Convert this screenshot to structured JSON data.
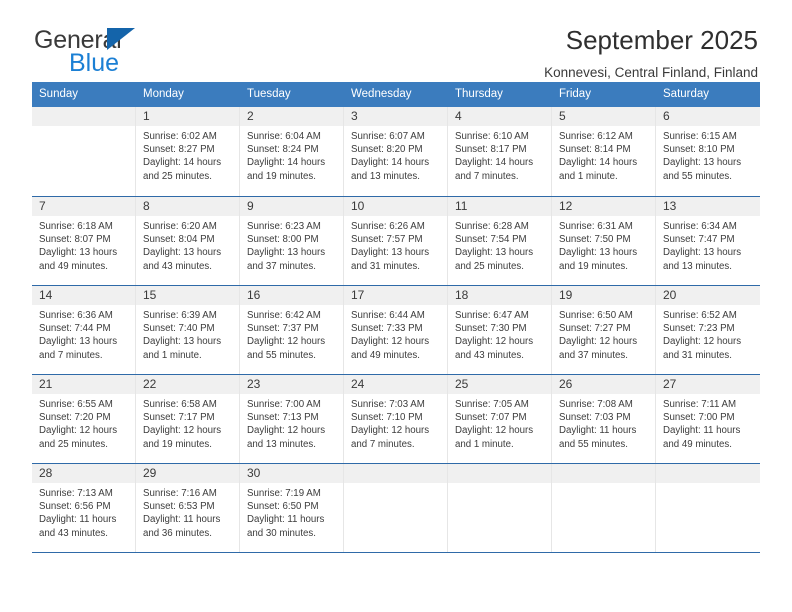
{
  "brand": {
    "name_part1": "General",
    "name_part2": "Blue",
    "triangle_color": "#1464aa",
    "blue_color": "#1b7fd4"
  },
  "header": {
    "title": "September 2025",
    "subtitle": "Konnevesi, Central Finland, Finland"
  },
  "theme": {
    "header_bg": "#3b7cbe",
    "row_rule": "#2f6aa8",
    "daynum_bg": "#f0f0f0",
    "text": "#3c3c3c"
  },
  "calendar": {
    "weekdays": [
      "Sunday",
      "Monday",
      "Tuesday",
      "Wednesday",
      "Thursday",
      "Friday",
      "Saturday"
    ],
    "weeks": [
      [
        {
          "day": "",
          "empty": true,
          "sunrise": "",
          "sunset": "",
          "daylight_line1": "",
          "daylight_line2": ""
        },
        {
          "day": "1",
          "sunrise": "Sunrise: 6:02 AM",
          "sunset": "Sunset: 8:27 PM",
          "daylight_line1": "Daylight: 14 hours",
          "daylight_line2": "and 25 minutes."
        },
        {
          "day": "2",
          "sunrise": "Sunrise: 6:04 AM",
          "sunset": "Sunset: 8:24 PM",
          "daylight_line1": "Daylight: 14 hours",
          "daylight_line2": "and 19 minutes."
        },
        {
          "day": "3",
          "sunrise": "Sunrise: 6:07 AM",
          "sunset": "Sunset: 8:20 PM",
          "daylight_line1": "Daylight: 14 hours",
          "daylight_line2": "and 13 minutes."
        },
        {
          "day": "4",
          "sunrise": "Sunrise: 6:10 AM",
          "sunset": "Sunset: 8:17 PM",
          "daylight_line1": "Daylight: 14 hours",
          "daylight_line2": "and 7 minutes."
        },
        {
          "day": "5",
          "sunrise": "Sunrise: 6:12 AM",
          "sunset": "Sunset: 8:14 PM",
          "daylight_line1": "Daylight: 14 hours",
          "daylight_line2": "and 1 minute."
        },
        {
          "day": "6",
          "sunrise": "Sunrise: 6:15 AM",
          "sunset": "Sunset: 8:10 PM",
          "daylight_line1": "Daylight: 13 hours",
          "daylight_line2": "and 55 minutes."
        }
      ],
      [
        {
          "day": "7",
          "sunrise": "Sunrise: 6:18 AM",
          "sunset": "Sunset: 8:07 PM",
          "daylight_line1": "Daylight: 13 hours",
          "daylight_line2": "and 49 minutes."
        },
        {
          "day": "8",
          "sunrise": "Sunrise: 6:20 AM",
          "sunset": "Sunset: 8:04 PM",
          "daylight_line1": "Daylight: 13 hours",
          "daylight_line2": "and 43 minutes."
        },
        {
          "day": "9",
          "sunrise": "Sunrise: 6:23 AM",
          "sunset": "Sunset: 8:00 PM",
          "daylight_line1": "Daylight: 13 hours",
          "daylight_line2": "and 37 minutes."
        },
        {
          "day": "10",
          "sunrise": "Sunrise: 6:26 AM",
          "sunset": "Sunset: 7:57 PM",
          "daylight_line1": "Daylight: 13 hours",
          "daylight_line2": "and 31 minutes."
        },
        {
          "day": "11",
          "sunrise": "Sunrise: 6:28 AM",
          "sunset": "Sunset: 7:54 PM",
          "daylight_line1": "Daylight: 13 hours",
          "daylight_line2": "and 25 minutes."
        },
        {
          "day": "12",
          "sunrise": "Sunrise: 6:31 AM",
          "sunset": "Sunset: 7:50 PM",
          "daylight_line1": "Daylight: 13 hours",
          "daylight_line2": "and 19 minutes."
        },
        {
          "day": "13",
          "sunrise": "Sunrise: 6:34 AM",
          "sunset": "Sunset: 7:47 PM",
          "daylight_line1": "Daylight: 13 hours",
          "daylight_line2": "and 13 minutes."
        }
      ],
      [
        {
          "day": "14",
          "sunrise": "Sunrise: 6:36 AM",
          "sunset": "Sunset: 7:44 PM",
          "daylight_line1": "Daylight: 13 hours",
          "daylight_line2": "and 7 minutes."
        },
        {
          "day": "15",
          "sunrise": "Sunrise: 6:39 AM",
          "sunset": "Sunset: 7:40 PM",
          "daylight_line1": "Daylight: 13 hours",
          "daylight_line2": "and 1 minute."
        },
        {
          "day": "16",
          "sunrise": "Sunrise: 6:42 AM",
          "sunset": "Sunset: 7:37 PM",
          "daylight_line1": "Daylight: 12 hours",
          "daylight_line2": "and 55 minutes."
        },
        {
          "day": "17",
          "sunrise": "Sunrise: 6:44 AM",
          "sunset": "Sunset: 7:33 PM",
          "daylight_line1": "Daylight: 12 hours",
          "daylight_line2": "and 49 minutes."
        },
        {
          "day": "18",
          "sunrise": "Sunrise: 6:47 AM",
          "sunset": "Sunset: 7:30 PM",
          "daylight_line1": "Daylight: 12 hours",
          "daylight_line2": "and 43 minutes."
        },
        {
          "day": "19",
          "sunrise": "Sunrise: 6:50 AM",
          "sunset": "Sunset: 7:27 PM",
          "daylight_line1": "Daylight: 12 hours",
          "daylight_line2": "and 37 minutes."
        },
        {
          "day": "20",
          "sunrise": "Sunrise: 6:52 AM",
          "sunset": "Sunset: 7:23 PM",
          "daylight_line1": "Daylight: 12 hours",
          "daylight_line2": "and 31 minutes."
        }
      ],
      [
        {
          "day": "21",
          "sunrise": "Sunrise: 6:55 AM",
          "sunset": "Sunset: 7:20 PM",
          "daylight_line1": "Daylight: 12 hours",
          "daylight_line2": "and 25 minutes."
        },
        {
          "day": "22",
          "sunrise": "Sunrise: 6:58 AM",
          "sunset": "Sunset: 7:17 PM",
          "daylight_line1": "Daylight: 12 hours",
          "daylight_line2": "and 19 minutes."
        },
        {
          "day": "23",
          "sunrise": "Sunrise: 7:00 AM",
          "sunset": "Sunset: 7:13 PM",
          "daylight_line1": "Daylight: 12 hours",
          "daylight_line2": "and 13 minutes."
        },
        {
          "day": "24",
          "sunrise": "Sunrise: 7:03 AM",
          "sunset": "Sunset: 7:10 PM",
          "daylight_line1": "Daylight: 12 hours",
          "daylight_line2": "and 7 minutes."
        },
        {
          "day": "25",
          "sunrise": "Sunrise: 7:05 AM",
          "sunset": "Sunset: 7:07 PM",
          "daylight_line1": "Daylight: 12 hours",
          "daylight_line2": "and 1 minute."
        },
        {
          "day": "26",
          "sunrise": "Sunrise: 7:08 AM",
          "sunset": "Sunset: 7:03 PM",
          "daylight_line1": "Daylight: 11 hours",
          "daylight_line2": "and 55 minutes."
        },
        {
          "day": "27",
          "sunrise": "Sunrise: 7:11 AM",
          "sunset": "Sunset: 7:00 PM",
          "daylight_line1": "Daylight: 11 hours",
          "daylight_line2": "and 49 minutes."
        }
      ],
      [
        {
          "day": "28",
          "sunrise": "Sunrise: 7:13 AM",
          "sunset": "Sunset: 6:56 PM",
          "daylight_line1": "Daylight: 11 hours",
          "daylight_line2": "and 43 minutes."
        },
        {
          "day": "29",
          "sunrise": "Sunrise: 7:16 AM",
          "sunset": "Sunset: 6:53 PM",
          "daylight_line1": "Daylight: 11 hours",
          "daylight_line2": "and 36 minutes."
        },
        {
          "day": "30",
          "sunrise": "Sunrise: 7:19 AM",
          "sunset": "Sunset: 6:50 PM",
          "daylight_line1": "Daylight: 11 hours",
          "daylight_line2": "and 30 minutes."
        },
        {
          "day": "",
          "empty": true,
          "sunrise": "",
          "sunset": "",
          "daylight_line1": "",
          "daylight_line2": ""
        },
        {
          "day": "",
          "empty": true,
          "sunrise": "",
          "sunset": "",
          "daylight_line1": "",
          "daylight_line2": ""
        },
        {
          "day": "",
          "empty": true,
          "sunrise": "",
          "sunset": "",
          "daylight_line1": "",
          "daylight_line2": ""
        },
        {
          "day": "",
          "empty": true,
          "sunrise": "",
          "sunset": "",
          "daylight_line1": "",
          "daylight_line2": ""
        }
      ]
    ]
  }
}
